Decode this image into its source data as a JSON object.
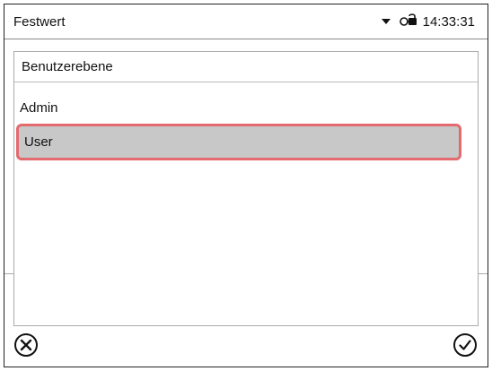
{
  "statusbar": {
    "title": "Festwert",
    "time": "14:33:31",
    "icons": [
      "dropdown-triangle-icon",
      "key-lock-icon"
    ]
  },
  "panel": {
    "header": "Benutzerebene",
    "items": [
      {
        "label": "Admin",
        "selected": false
      },
      {
        "label": "User",
        "selected": true
      }
    ]
  },
  "footer": {
    "cancel_icon": "cancel-circle-x-icon",
    "confirm_icon": "confirm-circle-check-icon"
  },
  "colors": {
    "selected_fill": "#c8c8c8",
    "selected_border": "#e36a6e"
  }
}
